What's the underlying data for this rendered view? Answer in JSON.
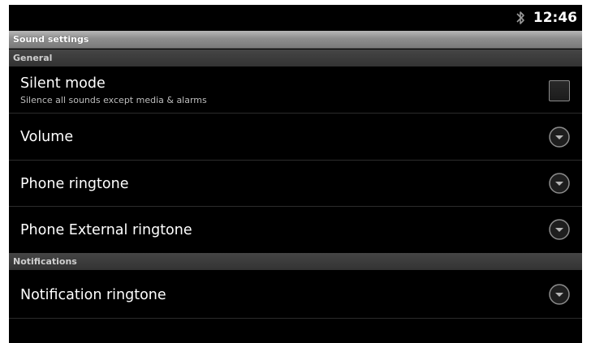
{
  "status_bar": {
    "time": "12:46",
    "icons": [
      "bluetooth-icon"
    ]
  },
  "title_bar": {
    "title": "Sound settings"
  },
  "sections": [
    {
      "header": "General",
      "items": [
        {
          "title": "Silent mode",
          "summary": "Silence all sounds except media & alarms",
          "widget": "checkbox",
          "checked": false
        },
        {
          "title": "Volume",
          "widget": "dropdown-icon"
        },
        {
          "title": "Phone ringtone",
          "widget": "dropdown-icon"
        },
        {
          "title": "Phone External ringtone",
          "widget": "dropdown-icon"
        }
      ]
    },
    {
      "header": "Notifications",
      "items": [
        {
          "title": "Notification ringtone",
          "widget": "dropdown-icon"
        }
      ]
    }
  ],
  "colors": {
    "background": "#000000",
    "title_bar": "#8e8e8e",
    "section_header": "#3a3a3a",
    "text_primary": "#ffffff",
    "text_secondary": "#bdbdbd"
  }
}
